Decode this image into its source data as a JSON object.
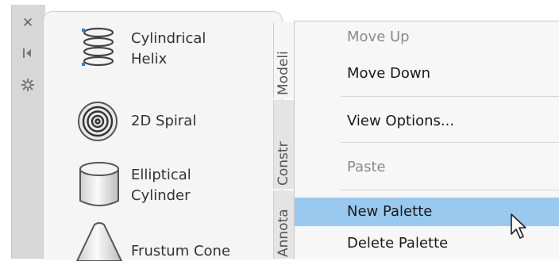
{
  "palette": {
    "strip_icons": [
      {
        "name": "close-icon",
        "glyph": "✕"
      },
      {
        "name": "auto-hide-icon",
        "glyph": "⇥"
      },
      {
        "name": "properties-icon",
        "glyph": "✲"
      }
    ],
    "tools": [
      {
        "label_line1": "Cylindrical",
        "label_line2": "Helix"
      },
      {
        "label_line1": "2D Spiral"
      },
      {
        "label_line1": "Elliptical",
        "label_line2": "Cylinder"
      },
      {
        "label_line1": "Frustum Cone"
      }
    ],
    "tabs": [
      "Modeli",
      "Constr",
      "Annota"
    ]
  },
  "context_menu": {
    "items": [
      {
        "label": "Move Up",
        "state": "disabled"
      },
      {
        "label": "Move Down",
        "state": "enabled"
      },
      {
        "label": "View Options...",
        "state": "enabled"
      },
      {
        "label": "Paste",
        "state": "disabled"
      },
      {
        "label": "New Palette",
        "state": "highlighted"
      },
      {
        "label": "Delete Palette",
        "state": "enabled"
      }
    ]
  },
  "colors": {
    "highlight": "#99c9ef",
    "menu_bg": "#f7f7f7",
    "palette_bg": "#f5f5f5"
  }
}
